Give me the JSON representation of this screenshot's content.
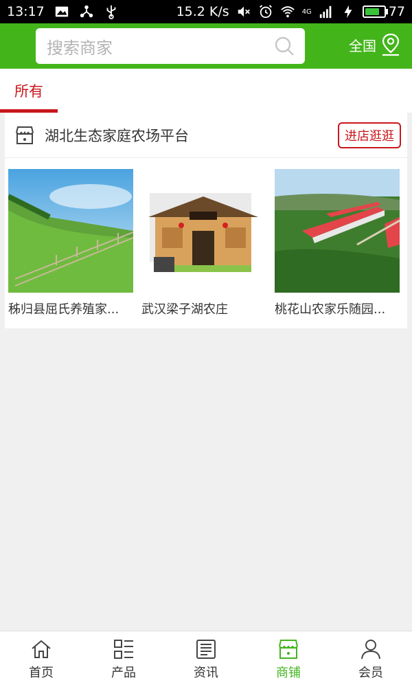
{
  "status_bar": {
    "time": "13:17",
    "speed": "15.2 K/s",
    "network": "4G",
    "battery": "77",
    "battery_level": 0.77
  },
  "header": {
    "search_placeholder": "搜索商家",
    "region": "全国"
  },
  "tabs": [
    {
      "label": "所有",
      "active": true
    }
  ],
  "store": {
    "name": "湖北生态家庭农场平台",
    "enter_label": "进店逛逛",
    "products": [
      {
        "title": "秭归县屈氏养殖家..."
      },
      {
        "title": "武汉梁子湖农庄"
      },
      {
        "title": "桃花山农家乐随园..."
      }
    ]
  },
  "bottom_nav": [
    {
      "label": "首页",
      "icon": "home-icon",
      "active": false
    },
    {
      "label": "产品",
      "icon": "grid-list-icon",
      "active": false
    },
    {
      "label": "资讯",
      "icon": "news-icon",
      "active": false
    },
    {
      "label": "商铺",
      "icon": "shop-icon",
      "active": true
    },
    {
      "label": "会员",
      "icon": "user-icon",
      "active": false
    }
  ],
  "colors": {
    "brand_green": "#43b51b",
    "accent_red": "#c9161d"
  }
}
